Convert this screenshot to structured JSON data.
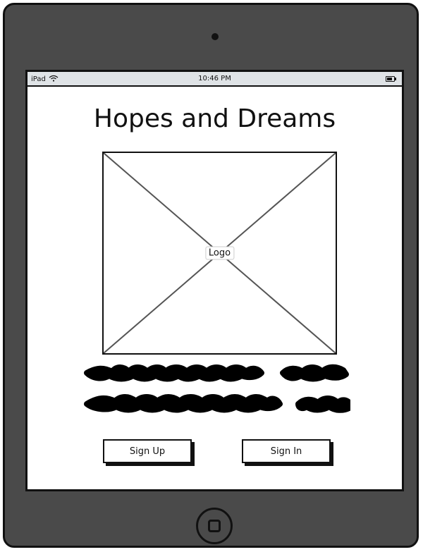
{
  "status_bar": {
    "device_name": "iPad",
    "time": "10:46 PM",
    "wifi_icon": "wifi-icon",
    "battery_icon": "battery-icon"
  },
  "main": {
    "title": "Hopes and Dreams",
    "logo_placeholder": {
      "label": "Logo",
      "icon": "image-placeholder-icon"
    },
    "text_placeholder": {
      "icon": "scribble-text-placeholder"
    },
    "buttons": {
      "sign_up": "Sign Up",
      "sign_in": "Sign In"
    }
  },
  "device": {
    "home_button_icon": "home-button-icon"
  },
  "colors": {
    "device_body": "#4a4a4a",
    "outline": "#111111",
    "status_bar_bg": "#dfe3e6",
    "screen_bg": "#ffffff"
  }
}
